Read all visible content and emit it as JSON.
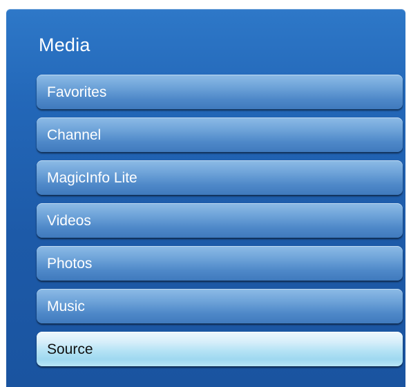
{
  "panel": {
    "title": "Media"
  },
  "menu": {
    "items": [
      {
        "label": "Favorites",
        "selected": false
      },
      {
        "label": "Channel",
        "selected": false
      },
      {
        "label": "MagicInfo Lite",
        "selected": false
      },
      {
        "label": "Videos",
        "selected": false
      },
      {
        "label": "Photos",
        "selected": false
      },
      {
        "label": "Music",
        "selected": false
      },
      {
        "label": "Source",
        "selected": true
      }
    ]
  },
  "colors": {
    "panel_blue": "#1d5aa8",
    "item_blue": "#5b93ce",
    "selected_cyan": "#b5e3f5"
  }
}
